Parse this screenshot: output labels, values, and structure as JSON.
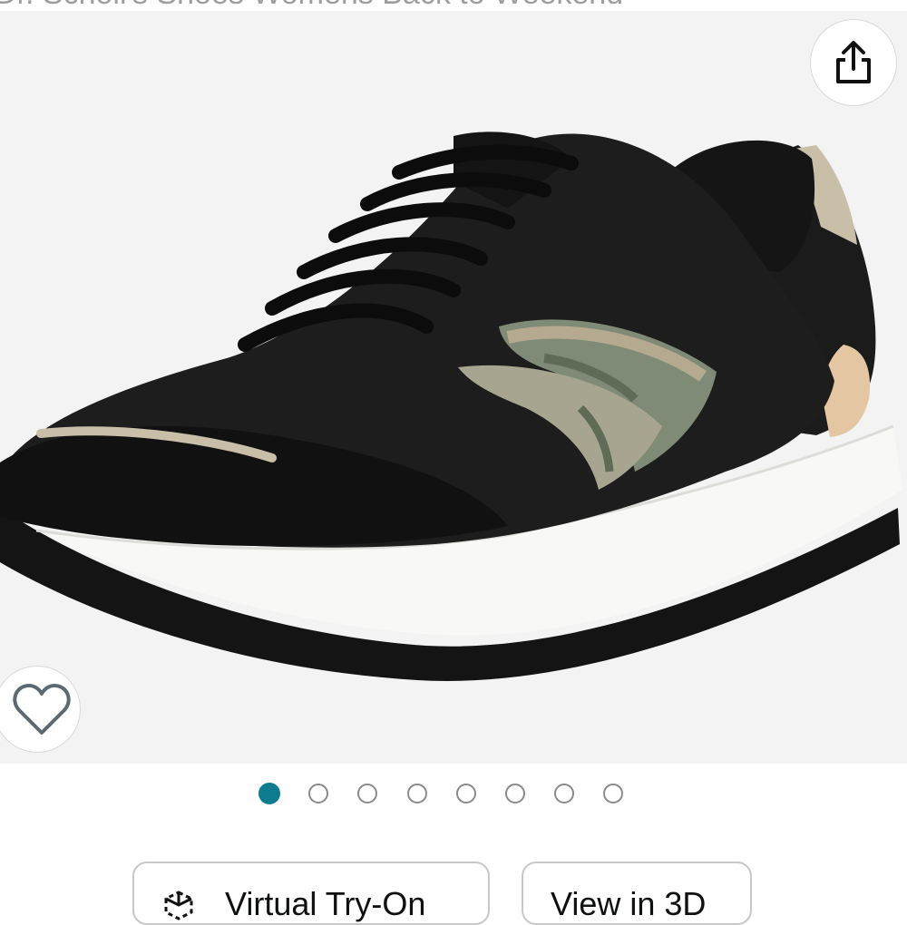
{
  "page": {
    "title_partial": "Dr. Scholl's Shoes Womens Back to Weekend"
  },
  "gallery": {
    "share_icon": "share-icon",
    "wishlist_icon": "heart-icon",
    "total_images": 8,
    "active_index": 0
  },
  "actions": {
    "virtual_try_on_label": "Virtual Try-On",
    "virtual_try_on_icon": "ar-cube-icon",
    "view_3d_label": "View in 3D"
  },
  "colors": {
    "active_dot": "#0f7b8f",
    "inactive_dot_border": "#8a8a8a",
    "gallery_background": "#f3f3f3"
  }
}
